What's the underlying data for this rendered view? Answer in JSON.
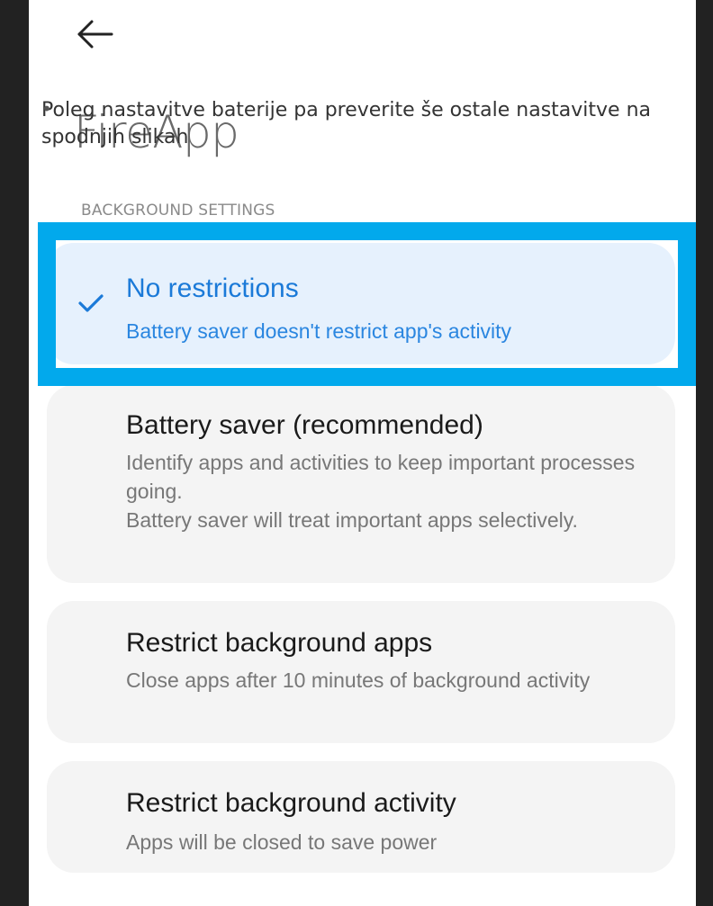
{
  "header": {
    "back_icon": "arrow-left-icon",
    "app_title": "FireApp"
  },
  "instruction": {
    "bullet": "•",
    "text": "Poleg nastavitve baterije pa preverite še ostale nastavitve na spodnjih slikah"
  },
  "section": {
    "label": "BACKGROUND SETTINGS"
  },
  "options": [
    {
      "title": "No restrictions",
      "description": "Battery saver doesn't restrict app's activity",
      "selected": true,
      "icon": "checkmark-icon"
    },
    {
      "title": "Battery saver (recommended)",
      "description": "Identify apps and activities to keep important processes going.\nBattery saver will treat important apps selectively.",
      "selected": false
    },
    {
      "title": "Restrict background apps",
      "description": "Close apps after 10 minutes of background activity",
      "selected": false
    },
    {
      "title": "Restrict background activity",
      "description": "Apps will be closed to save power",
      "selected": false
    }
  ],
  "colors": {
    "highlight": "#02a9ec",
    "selected_text": "#1b7ad8",
    "selected_bg": "#e6f1fd",
    "card_bg": "#f4f4f4"
  }
}
